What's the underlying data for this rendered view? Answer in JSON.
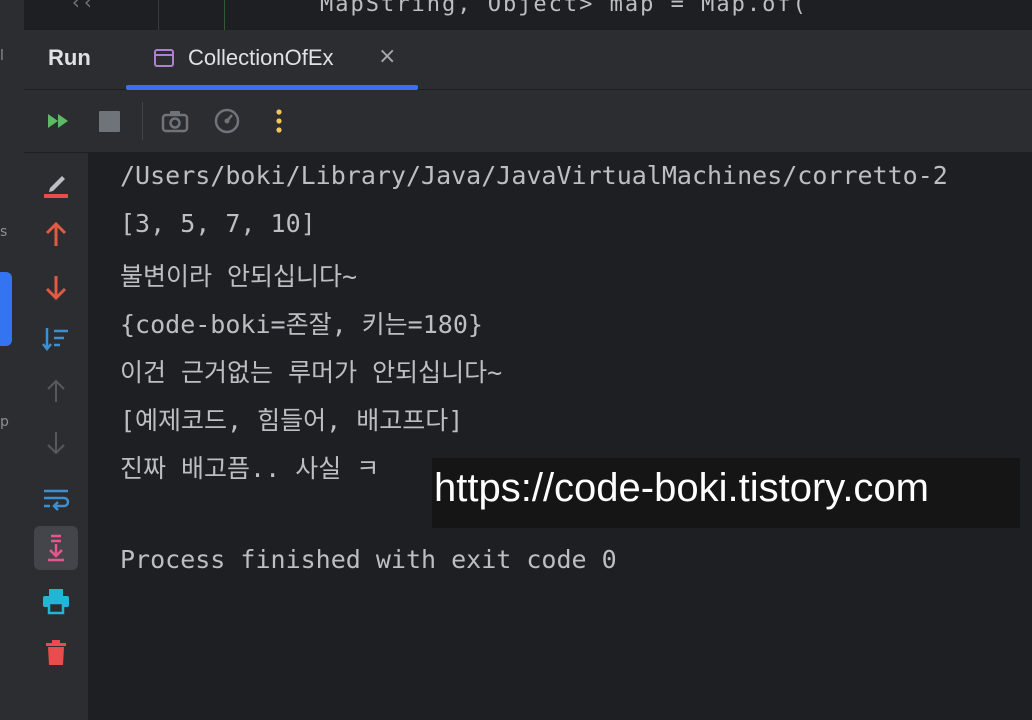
{
  "editor": {
    "code_fragment": "MapString, Object> map = Map.of("
  },
  "run_panel": {
    "title": "Run",
    "tab": {
      "label": "CollectionOfEx",
      "close_glyph": "×"
    }
  },
  "toolbar": {
    "buttons": [
      {
        "icon": "rerun-icon",
        "color": "#5fb865"
      },
      {
        "icon": "stop-icon",
        "color": "#6f737a"
      },
      {
        "icon": "camera-icon",
        "color": "#6f737a"
      },
      {
        "icon": "gauge-icon",
        "color": "#6f737a"
      },
      {
        "icon": "more-vertical-icon",
        "color": "#f2c55c"
      }
    ]
  },
  "side_actions": [
    {
      "icon": "clear-edit-icon"
    },
    {
      "icon": "arrow-up-icon",
      "color": "#e05a44"
    },
    {
      "icon": "arrow-down-icon",
      "color": "#e05a44"
    },
    {
      "icon": "sort-icon",
      "color": "#3d8fd1"
    },
    {
      "icon": "arrow-up-disabled-icon"
    },
    {
      "icon": "arrow-down-disabled-icon"
    },
    {
      "icon": "soft-wrap-icon",
      "color": "#3d8fd1"
    },
    {
      "icon": "scroll-to-end-icon",
      "color": "#e8548c"
    },
    {
      "icon": "print-icon",
      "color": "#21b5d6"
    },
    {
      "icon": "trash-icon",
      "color": "#e84c4c"
    }
  ],
  "console": {
    "lines": [
      "/Users/boki/Library/Java/JavaVirtualMachines/corretto-2",
      "[3, 5, 7, 10]",
      "불변이라 안되십니다~",
      "{code-boki=존잘, 키는=180}",
      "이건 근거없는 루머가 안되십니다~",
      "[예제코드, 힘들어, 배고프다]",
      "진짜 배고픔.. 사실 ㅋ",
      "",
      "Process finished with exit code 0"
    ]
  },
  "watermark": "https://code-boki.tistory.com",
  "left_strip": {
    "glyphs": [
      "l",
      "s",
      "p"
    ]
  },
  "colors": {
    "accent": "#3574f0",
    "panel_bg": "#2b2d30",
    "console_bg": "#1e1f22",
    "text": "#bcbec4"
  }
}
